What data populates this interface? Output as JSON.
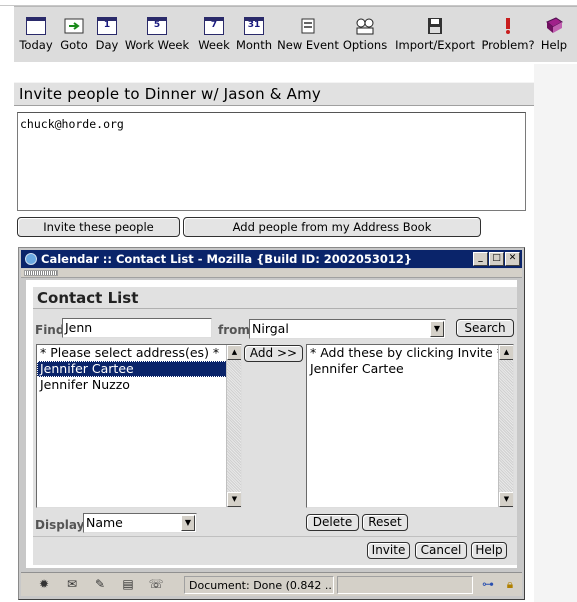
{
  "toolbar": {
    "items": [
      {
        "label": "Today",
        "icon": "calendar-today-icon"
      },
      {
        "label": "Goto",
        "icon": "goto-arrow-icon"
      },
      {
        "label": "Day",
        "icon": "calendar-day-icon",
        "glyph": "1"
      },
      {
        "label": "Work Week",
        "icon": "calendar-workweek-icon",
        "glyph": "5"
      },
      {
        "label": "Week",
        "icon": "calendar-week-icon",
        "glyph": "7"
      },
      {
        "label": "Month",
        "icon": "calendar-month-icon",
        "glyph": "31"
      },
      {
        "label": "New Event",
        "icon": "new-event-icon"
      },
      {
        "label": "Options",
        "icon": "options-icon"
      },
      {
        "label": "Import/Export",
        "icon": "floppy-disk-icon"
      },
      {
        "label": "Problem?",
        "icon": "problem-icon"
      },
      {
        "label": "Help",
        "icon": "help-book-icon"
      }
    ]
  },
  "page": {
    "title": "Invite people to Dinner w/ Jason & Amy",
    "emails_value": "chuck@horde.org",
    "invite_button": "Invite these people",
    "address_book_button": "Add people from my Address Book"
  },
  "popup": {
    "window_title": "Calendar :: Contact List - Mozilla {Build ID: 2002053012}",
    "minimize": "_",
    "maximize": "□",
    "close": "✕",
    "heading": "Contact List",
    "find_label": "Find",
    "find_value": "Jenn",
    "from_label": "from",
    "from_value": "Nirgal",
    "search_button": "Search",
    "add_button": "Add >>",
    "results": [
      {
        "text": "* Please select address(es) *",
        "selected": false
      },
      {
        "text": "Jennifer Cartee",
        "selected": true
      },
      {
        "text": "Jennifer Nuzzo",
        "selected": false
      }
    ],
    "chosen": [
      {
        "text": "* Add these by clicking Invite *"
      },
      {
        "text": "Jennifer Cartee"
      }
    ],
    "delete_button": "Delete",
    "reset_button": "Reset",
    "display_label": "Display",
    "display_value": "Name",
    "invite_button": "Invite",
    "cancel_button": "Cancel",
    "help_button": "Help",
    "status_text": "Document: Done (0.842 ..."
  },
  "colors": {
    "titlebar": "#0a246a",
    "selection": "#0a246a",
    "panel": "#e1e1e1"
  }
}
